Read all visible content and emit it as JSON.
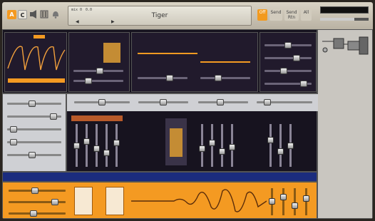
{
  "colors": {
    "accent": "#f49a22",
    "panel_dark": "#211a2c",
    "panel_light": "#cfd0d4",
    "blue_strip": "#1b2c7e",
    "waveform": "#f2a03c"
  },
  "topbar": {
    "logo_a": "A",
    "logo_c": "C",
    "preset_label": "Tiger",
    "display_small_1": "mix 0",
    "display_small_2": "0.0",
    "prev_arrow": "◀",
    "next_arrow": "▶",
    "modes": [
      {
        "label": "Off",
        "state": "active"
      },
      {
        "label": "Send",
        "state": "idle"
      },
      {
        "label": "Send Rtn",
        "state": "idle"
      },
      {
        "label": "All",
        "state": "idle"
      }
    ]
  },
  "icons": [
    "speaker-icon",
    "mixer-icon",
    "bell-icon"
  ]
}
